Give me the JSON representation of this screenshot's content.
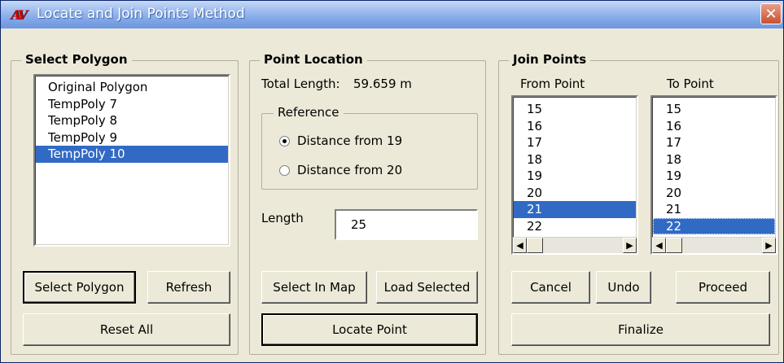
{
  "window": {
    "title": "Locate and Join Points Method",
    "close_glyph": "✕",
    "app_icon": "AV"
  },
  "select_polygon": {
    "title": "Select Polygon",
    "items": [
      "Original Polygon",
      "TempPoly 7",
      "TempPoly 8",
      "TempPoly 9",
      "TempPoly 10"
    ],
    "selected": "TempPoly 10",
    "select_button": "Select Polygon",
    "refresh_button": "Refresh",
    "reset_button": "Reset All"
  },
  "point_location": {
    "title": "Point Location",
    "total_length_label": "Total Length:",
    "total_length_value": "59.659 m",
    "reference": {
      "title": "Reference",
      "options": [
        "Distance from 19",
        "Distance from 20"
      ],
      "selected": "Distance from 19"
    },
    "length_label": "Length",
    "length_value": "25",
    "select_in_map_button": "Select In Map",
    "load_selected_button": "Load Selected",
    "locate_point_button": "Locate Point"
  },
  "join_points": {
    "title": "Join Points",
    "from_label": "From Point",
    "to_label": "To Point",
    "from_items": [
      "15",
      "16",
      "17",
      "18",
      "19",
      "20",
      "21",
      "22"
    ],
    "from_selected": "21",
    "to_items": [
      "15",
      "16",
      "17",
      "18",
      "19",
      "20",
      "21",
      "22"
    ],
    "to_selected": "22",
    "cancel_button": "Cancel",
    "undo_button": "Undo",
    "proceed_button": "Proceed",
    "finalize_button": "Finalize",
    "scroll_left_glyph": "◀",
    "scroll_right_glyph": "▶"
  },
  "colors": {
    "selection": "#316ac5",
    "titlebar": "#7ea5e6",
    "dialog_bg": "#ece9d8",
    "close": "#c8502f"
  }
}
